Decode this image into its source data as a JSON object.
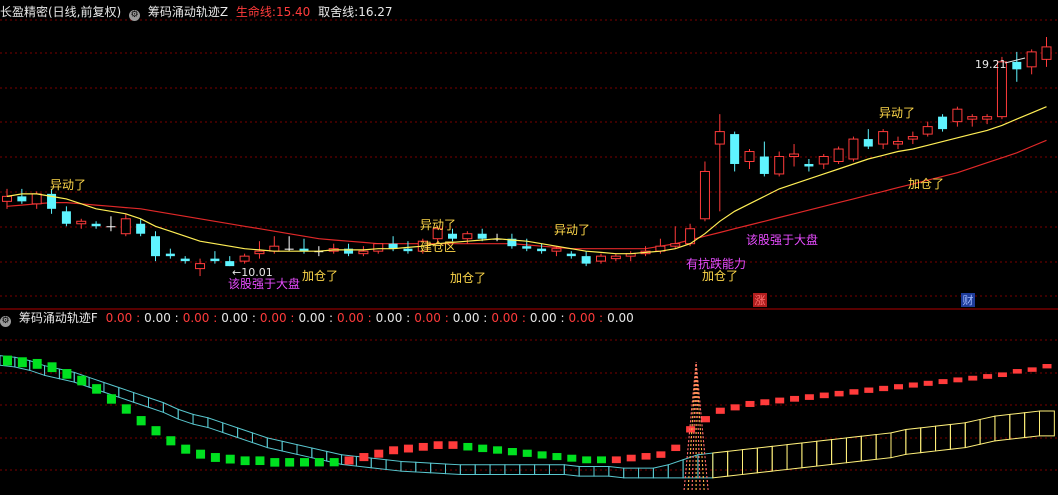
{
  "header_main": {
    "title": "长盈精密(日线,前复权)",
    "indicator": "筹码涌动轨迹Z",
    "life_label": "生命线:",
    "life_value": "15.40",
    "exit_label": "取舍线:",
    "exit_value": "16.27"
  },
  "header_sub": {
    "indicator": "筹码涌动轨迹F",
    "values": [
      "0.00",
      "0.00",
      "0.00",
      "0.00",
      "0.00",
      "0.00",
      "0.00",
      "0.00",
      "0.00",
      "0.00",
      "0.00",
      "0.00",
      "0.00",
      "0.00"
    ]
  },
  "annotations": [
    {
      "text": "异动了",
      "color": "#ffd84a"
    },
    {
      "text": "加仓了",
      "color": "#ffd84a"
    },
    {
      "text": "该股强于大盘",
      "color": "#e84cff"
    },
    {
      "text": "异动了",
      "color": "#ffd84a"
    },
    {
      "text": "建仓区",
      "color": "#ffd84a"
    },
    {
      "text": "加仓了",
      "color": "#ffd84a"
    },
    {
      "text": "异动了",
      "color": "#ffd84a"
    },
    {
      "text": "有抗跌能力",
      "color": "#e84cff"
    },
    {
      "text": "加仓了",
      "color": "#ffd84a"
    },
    {
      "text": "该股强于大盘",
      "color": "#e84cff"
    },
    {
      "text": "异动了",
      "color": "#ffd84a"
    },
    {
      "text": "加仓了",
      "color": "#ffd84a"
    }
  ],
  "price_marks": {
    "low": "10.01",
    "high": "19.21"
  },
  "badges": [
    {
      "text": "涨"
    },
    {
      "text": "财"
    }
  ],
  "colors": {
    "up": "#ff3b3b",
    "down": "#5ff4ff",
    "flat": "#ffffff",
    "ma_short": "#ffee55",
    "ma_long": "#e02828",
    "grid": "#7a0000",
    "green": "#00e020",
    "cyan_band": "#59c7cf",
    "yellow_band": "#fff07a",
    "badge": "#b01e1e",
    "badge2": "#1e3c9a"
  },
  "chart_data": {
    "type": "candlestick",
    "y_range": [
      9.2,
      20.2
    ],
    "candles": [
      [
        13.0,
        13.5,
        12.7,
        13.2
      ],
      [
        13.2,
        13.5,
        12.9,
        13.0
      ],
      [
        12.9,
        13.4,
        12.7,
        13.3
      ],
      [
        13.3,
        13.5,
        12.5,
        12.7
      ],
      [
        12.6,
        12.8,
        12.0,
        12.1
      ],
      [
        12.1,
        12.3,
        11.9,
        12.2
      ],
      [
        12.1,
        12.2,
        11.9,
        12.0
      ],
      [
        12.0,
        12.4,
        11.8,
        12.0
      ],
      [
        11.7,
        12.5,
        11.6,
        12.3
      ],
      [
        12.1,
        12.3,
        11.6,
        11.7
      ],
      [
        11.6,
        11.8,
        10.6,
        10.8
      ],
      [
        10.9,
        11.1,
        10.7,
        10.8
      ],
      [
        10.7,
        10.8,
        10.5,
        10.6
      ],
      [
        10.3,
        10.7,
        10.0,
        10.5
      ],
      [
        10.7,
        11.0,
        10.5,
        10.6
      ],
      [
        10.6,
        10.8,
        10.4,
        10.4
      ],
      [
        10.6,
        10.9,
        10.5,
        10.8
      ],
      [
        10.9,
        11.4,
        10.7,
        11.0
      ],
      [
        11.0,
        11.6,
        10.9,
        11.2
      ],
      [
        11.1,
        11.6,
        11.0,
        11.1
      ],
      [
        11.1,
        11.5,
        10.9,
        11.0
      ],
      [
        11.0,
        11.2,
        10.8,
        11.0
      ],
      [
        11.0,
        11.3,
        10.9,
        11.1
      ],
      [
        11.1,
        11.3,
        10.8,
        10.9
      ],
      [
        10.9,
        11.2,
        10.8,
        11.0
      ],
      [
        11.0,
        11.3,
        10.9,
        11.3
      ],
      [
        11.3,
        11.6,
        11.0,
        11.1
      ],
      [
        11.1,
        11.4,
        10.9,
        11.0
      ],
      [
        11.0,
        11.5,
        10.9,
        11.4
      ],
      [
        11.5,
        12.0,
        11.3,
        11.9
      ],
      [
        11.7,
        11.9,
        11.4,
        11.5
      ],
      [
        11.5,
        11.8,
        11.3,
        11.7
      ],
      [
        11.7,
        11.9,
        11.4,
        11.5
      ],
      [
        11.5,
        11.7,
        11.4,
        11.5
      ],
      [
        11.5,
        11.7,
        11.1,
        11.2
      ],
      [
        11.2,
        11.5,
        11.0,
        11.1
      ],
      [
        11.1,
        11.3,
        10.9,
        11.0
      ],
      [
        11.0,
        11.2,
        10.8,
        11.1
      ],
      [
        10.9,
        11.0,
        10.7,
        10.8
      ],
      [
        10.8,
        11.0,
        10.4,
        10.5
      ],
      [
        10.6,
        10.9,
        10.5,
        10.8
      ],
      [
        10.7,
        10.9,
        10.6,
        10.8
      ],
      [
        10.8,
        11.0,
        10.6,
        10.9
      ],
      [
        10.9,
        11.2,
        10.8,
        11.0
      ],
      [
        11.0,
        11.5,
        10.9,
        11.2
      ],
      [
        11.2,
        12.0,
        11.1,
        11.3
      ],
      [
        11.3,
        12.1,
        11.2,
        11.9
      ],
      [
        12.3,
        14.6,
        12.2,
        14.2
      ],
      [
        15.3,
        16.5,
        12.6,
        15.8
      ],
      [
        15.7,
        15.8,
        14.2,
        14.5
      ],
      [
        14.6,
        15.1,
        14.3,
        15.0
      ],
      [
        14.8,
        15.4,
        14.0,
        14.1
      ],
      [
        14.1,
        15.0,
        14.0,
        14.8
      ],
      [
        14.8,
        15.3,
        14.4,
        14.9
      ],
      [
        14.5,
        14.7,
        14.2,
        14.4
      ],
      [
        14.5,
        14.9,
        14.3,
        14.8
      ],
      [
        14.6,
        15.2,
        14.5,
        15.1
      ],
      [
        14.7,
        15.6,
        14.6,
        15.5
      ],
      [
        15.5,
        15.9,
        15.1,
        15.2
      ],
      [
        15.3,
        15.9,
        15.1,
        15.8
      ],
      [
        15.3,
        15.6,
        15.1,
        15.4
      ],
      [
        15.5,
        15.8,
        15.3,
        15.6
      ],
      [
        15.7,
        16.2,
        15.6,
        16.0
      ],
      [
        16.4,
        16.5,
        15.8,
        15.9
      ],
      [
        16.2,
        16.8,
        16.0,
        16.7
      ],
      [
        16.3,
        16.5,
        16.0,
        16.4
      ],
      [
        16.3,
        16.5,
        16.1,
        16.4
      ],
      [
        16.4,
        18.8,
        16.3,
        18.6
      ],
      [
        18.6,
        19.0,
        17.8,
        18.3
      ],
      [
        18.4,
        19.1,
        18.1,
        19.0
      ],
      [
        18.7,
        19.6,
        18.4,
        19.2
      ]
    ],
    "ma_short": [
      13.2,
      13.3,
      13.3,
      13.2,
      13.1,
      12.9,
      12.7,
      12.6,
      12.5,
      12.3,
      12.0,
      11.8,
      11.6,
      11.4,
      11.3,
      11.2,
      11.1,
      11.05,
      11.0,
      11.0,
      11.0,
      11.0,
      11.05,
      11.05,
      11.05,
      11.1,
      11.1,
      11.15,
      11.2,
      11.3,
      11.35,
      11.4,
      11.45,
      11.5,
      11.45,
      11.4,
      11.3,
      11.2,
      11.1,
      11.0,
      10.95,
      10.9,
      10.9,
      10.95,
      11.0,
      11.1,
      11.3,
      11.7,
      12.2,
      12.6,
      12.9,
      13.2,
      13.5,
      13.7,
      13.9,
      14.1,
      14.3,
      14.5,
      14.7,
      14.85,
      15.0,
      15.1,
      15.25,
      15.4,
      15.55,
      15.7,
      15.85,
      16.05,
      16.3,
      16.55,
      16.8
    ],
    "ma_long": [
      12.8,
      12.85,
      12.9,
      12.95,
      12.95,
      12.9,
      12.85,
      12.8,
      12.75,
      12.7,
      12.6,
      12.5,
      12.4,
      12.3,
      12.2,
      12.1,
      12.0,
      11.9,
      11.8,
      11.7,
      11.6,
      11.5,
      11.45,
      11.4,
      11.35,
      11.3,
      11.3,
      11.3,
      11.3,
      11.3,
      11.3,
      11.3,
      11.3,
      11.3,
      11.3,
      11.25,
      11.2,
      11.15,
      11.1,
      11.1,
      11.1,
      11.1,
      11.1,
      11.1,
      11.2,
      11.3,
      11.45,
      11.6,
      11.75,
      11.9,
      12.05,
      12.2,
      12.35,
      12.5,
      12.65,
      12.8,
      12.95,
      13.1,
      13.25,
      13.4,
      13.55,
      13.7,
      13.85,
      14.0,
      14.15,
      14.35,
      14.55,
      14.75,
      14.95,
      15.2,
      15.45
    ],
    "sub_band_top": [
      0.2,
      0.21,
      0.23,
      0.26,
      0.28,
      0.3,
      0.33,
      0.36,
      0.39,
      0.42,
      0.45,
      0.48,
      0.52,
      0.55,
      0.57,
      0.6,
      0.63,
      0.66,
      0.69,
      0.71,
      0.73,
      0.75,
      0.77,
      0.79,
      0.8,
      0.81,
      0.82,
      0.83,
      0.835,
      0.84,
      0.845,
      0.85,
      0.85,
      0.85,
      0.85,
      0.85,
      0.85,
      0.85,
      0.85,
      0.86,
      0.86,
      0.86,
      0.87,
      0.87,
      0.87,
      0.85,
      0.82,
      0.79,
      0.78,
      0.77,
      0.76,
      0.75,
      0.74,
      0.73,
      0.72,
      0.71,
      0.7,
      0.69,
      0.68,
      0.67,
      0.66,
      0.64,
      0.63,
      0.62,
      0.61,
      0.6,
      0.58,
      0.56,
      0.55,
      0.54,
      0.53
    ],
    "sub_band_bot": [
      0.21,
      0.22,
      0.24,
      0.27,
      0.29,
      0.31,
      0.34,
      0.37,
      0.4,
      0.43,
      0.46,
      0.49,
      0.53,
      0.56,
      0.58,
      0.61,
      0.64,
      0.67,
      0.7,
      0.72,
      0.74,
      0.76,
      0.78,
      0.8,
      0.81,
      0.82,
      0.83,
      0.84,
      0.845,
      0.85,
      0.855,
      0.86,
      0.86,
      0.86,
      0.86,
      0.86,
      0.86,
      0.86,
      0.86,
      0.87,
      0.87,
      0.87,
      0.88,
      0.88,
      0.88,
      0.88,
      0.88,
      0.88,
      0.88,
      0.87,
      0.86,
      0.85,
      0.84,
      0.83,
      0.82,
      0.81,
      0.8,
      0.79,
      0.78,
      0.77,
      0.76,
      0.74,
      0.73,
      0.72,
      0.71,
      0.7,
      0.68,
      0.66,
      0.65,
      0.64,
      0.63
    ],
    "sub_bars": [
      0.2,
      0.21,
      0.22,
      0.24,
      0.28,
      0.32,
      0.37,
      0.43,
      0.49,
      0.56,
      0.62,
      0.68,
      0.73,
      0.76,
      0.78,
      0.79,
      0.8,
      0.8,
      0.81,
      0.81,
      0.81,
      0.81,
      0.81,
      0.8,
      0.78,
      0.76,
      0.74,
      0.73,
      0.72,
      0.71,
      0.71,
      0.72,
      0.73,
      0.74,
      0.75,
      0.76,
      0.77,
      0.78,
      0.79,
      0.8,
      0.8,
      0.8,
      0.79,
      0.78,
      0.77,
      0.73,
      0.62,
      0.56,
      0.51,
      0.49,
      0.47,
      0.46,
      0.45,
      0.44,
      0.43,
      0.42,
      0.41,
      0.4,
      0.39,
      0.38,
      0.37,
      0.36,
      0.35,
      0.34,
      0.33,
      0.32,
      0.31,
      0.3,
      0.28,
      0.27,
      0.25
    ],
    "sub_bar_sign": [
      -1,
      -1,
      -1,
      -1,
      -1,
      -1,
      -1,
      -1,
      -1,
      -1,
      -1,
      -1,
      -1,
      -1,
      -1,
      -1,
      -1,
      -1,
      -1,
      -1,
      -1,
      -1,
      -1,
      1,
      1,
      1,
      1,
      1,
      1,
      1,
      1,
      -1,
      -1,
      -1,
      -1,
      -1,
      -1,
      -1,
      -1,
      -1,
      -1,
      1,
      1,
      1,
      1,
      1,
      1,
      1,
      1,
      1,
      1,
      1,
      1,
      1,
      1,
      1,
      1,
      1,
      1,
      1,
      1,
      1,
      1,
      1,
      1,
      1,
      1,
      1,
      1,
      1,
      1
    ]
  }
}
